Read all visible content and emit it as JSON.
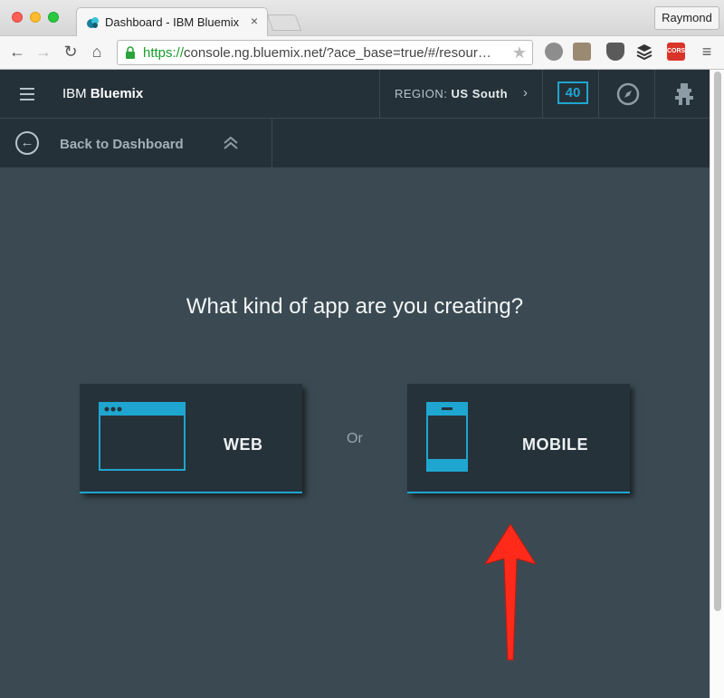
{
  "browser": {
    "tab_title": "Dashboard - IBM Bluemix",
    "tab_close": "×",
    "profile_name": "Raymond",
    "url_scheme": "https://",
    "url_rest": "console.ng.bluemix.net/?ace_base=true/#/resour…",
    "extension_cors_label": "CORS"
  },
  "app_header": {
    "brand_prefix": "IBM",
    "brand_name": "Bluemix",
    "region_label": "REGION:",
    "region_value": "US South",
    "notification_count": "40"
  },
  "sub_header": {
    "back_label": "Back to Dashboard"
  },
  "main": {
    "question": "What kind of app are you creating?",
    "web_label": "WEB",
    "or_label": "Or",
    "mobile_label": "MOBILE"
  },
  "colors": {
    "accent": "#1fa6d0",
    "header_bg": "#253139",
    "page_bg": "#3b4a52",
    "card_bg": "#26323a",
    "annotation_arrow": "#ff2a1a"
  }
}
